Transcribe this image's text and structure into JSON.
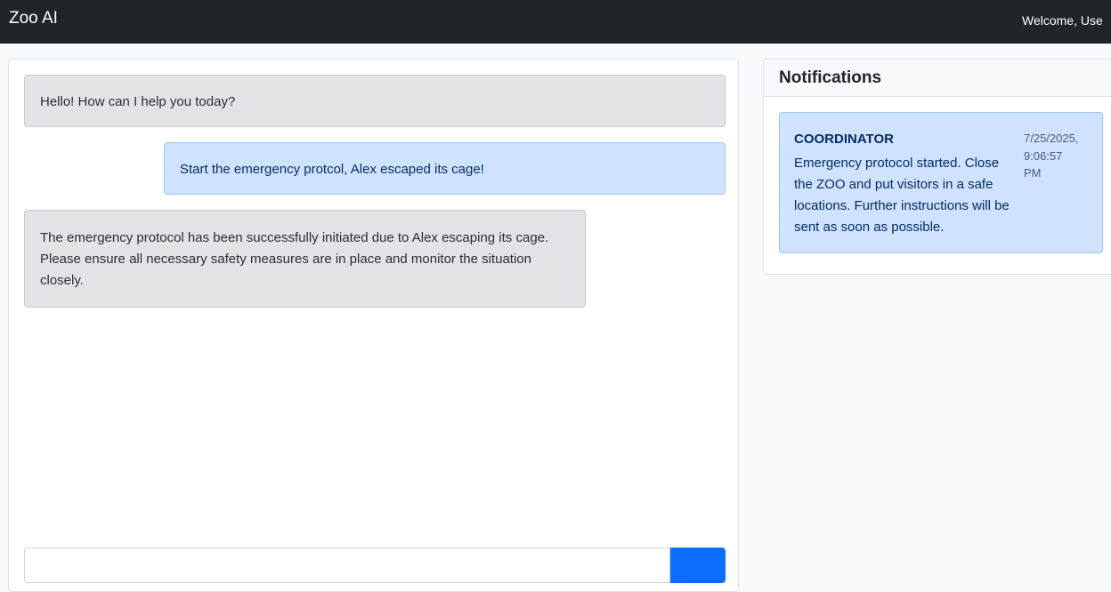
{
  "navbar": {
    "brand": "Zoo AI",
    "welcome": "Welcome, Use"
  },
  "chat": {
    "messages": [
      {
        "role": "assistant",
        "text": "Hello! How can I help you today?"
      },
      {
        "role": "user",
        "text": "Start the emergency protcol, Alex escaped its cage!"
      },
      {
        "role": "assistant",
        "text": "The emergency protocol has been successfully initiated due to Alex escaping its cage. Please ensure all necessary safety measures are in place and monitor the situation closely."
      }
    ],
    "input": {
      "value": "",
      "placeholder": ""
    },
    "send_label": ""
  },
  "notifications": {
    "title": "Notifications",
    "items": [
      {
        "sender": "COORDINATOR",
        "message": "Emergency protocol started. Close the ZOO and put visitors in a safe locations. Further instructions will be sent as soon as possible.",
        "date": "7/25/2025,",
        "time": "9:06:57",
        "period": "PM"
      }
    ]
  },
  "colors": {
    "navbar_bg": "#212529",
    "assistant_bubble": "#e2e3e5",
    "user_bubble": "#cfe2ff",
    "notification_bg": "#cfe2ff",
    "primary": "#0d6efd"
  }
}
